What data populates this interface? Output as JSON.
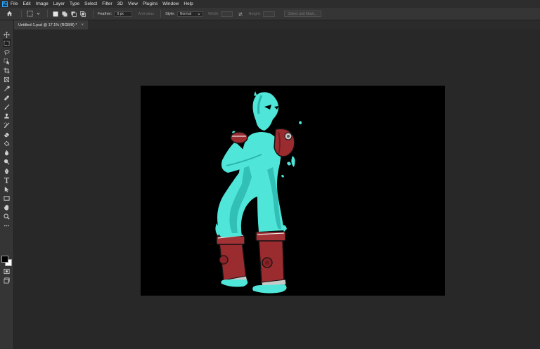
{
  "app": {
    "logo": "Ps"
  },
  "menu": [
    "File",
    "Edit",
    "Image",
    "Layer",
    "Type",
    "Select",
    "Filter",
    "3D",
    "View",
    "Plugins",
    "Window",
    "Help"
  ],
  "options": {
    "feather_label": "Feather:",
    "feather_value": "0 px",
    "antialias_label": "Anti-alias",
    "style_label": "Style:",
    "style_value": "Normal",
    "width_label": "Width:",
    "height_label": "Height:",
    "select_mask_label": "Select and Mask..."
  },
  "document": {
    "tab_title": "Untitled-1.psd @ 17.1% (RGB/8) *",
    "close_glyph": "×"
  },
  "tools": [
    "move-tool",
    "marquee-tool",
    "lasso-tool",
    "object-select-tool",
    "crop-tool",
    "frame-tool",
    "eyedropper-tool",
    "healing-brush-tool",
    "brush-tool",
    "clone-stamp-tool",
    "history-brush-tool",
    "eraser-tool",
    "paint-bucket-tool",
    "blur-tool",
    "dodge-tool",
    "pen-tool",
    "type-tool",
    "path-select-tool",
    "rectangle-tool",
    "hand-tool",
    "zoom-tool",
    "more-tools"
  ],
  "colors": {
    "foreground": "#000000",
    "background": "#ffffff",
    "figure_cyan": "#4fe5d8",
    "figure_shadow": "#2ab5ad",
    "hydrant_red": "#9a2b2f"
  }
}
